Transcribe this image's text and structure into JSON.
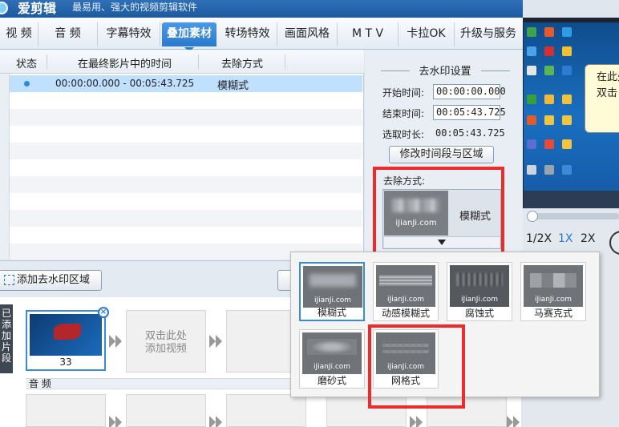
{
  "app": {
    "name": "爱剪辑",
    "slogan": "最易用、强大的视频剪辑软件"
  },
  "tabs": [
    {
      "label": "视 频",
      "active": false
    },
    {
      "label": "音 频",
      "active": false
    },
    {
      "label": "字幕特效",
      "active": false
    },
    {
      "label": "叠加素材",
      "active": true
    },
    {
      "label": "转场特效",
      "active": false
    },
    {
      "label": "画面风格",
      "active": false
    },
    {
      "label": "M T V",
      "active": false
    },
    {
      "label": "卡拉OK",
      "active": false
    },
    {
      "label": "升级与服务",
      "active": false
    }
  ],
  "list": {
    "headers": {
      "status": "状态",
      "time": "在最终影片中的时间",
      "method": "去除方式"
    },
    "rows": [
      {
        "time": "00:00:00.000 - 00:05:43.725",
        "method": "模糊式"
      }
    ]
  },
  "settings": {
    "title": "去水印设置",
    "start_label": "开始时间:",
    "start_value": "00:00:00.000",
    "end_label": "结束时间:",
    "end_value": "00:05:43.725",
    "duration_label": "选取时长:",
    "duration_value": "00:05:43.725",
    "modify_button": "修改时间段与区域",
    "method_label": "去除方式:",
    "current_method": "模糊式",
    "watermark_text": "iJianJi.com"
  },
  "popup": {
    "options": [
      "模糊式",
      "动感模糊式",
      "腐蚀式",
      "马赛克式",
      "磨砂式",
      "网格式"
    ],
    "selected": "模糊式",
    "watermark_text": "iJianJi.com"
  },
  "toolbar": {
    "add_watermark_area": "添加去水印区域"
  },
  "storyboard": {
    "side_label": "已添加片段",
    "clip_count": "33",
    "add_video_hint_line1": "双击此处",
    "add_video_hint_line2": "添加视频",
    "audio_label": "音 频"
  },
  "preview": {
    "tooltip_line1": "在此处",
    "tooltip_line2": "双击",
    "speeds": [
      "1/2X",
      "1X",
      "2X"
    ],
    "active_speed": "1X"
  },
  "colors": {
    "accent": "#2a7acd",
    "highlight_red": "#ee2b2b",
    "selected_row": "#bfe0ff"
  }
}
